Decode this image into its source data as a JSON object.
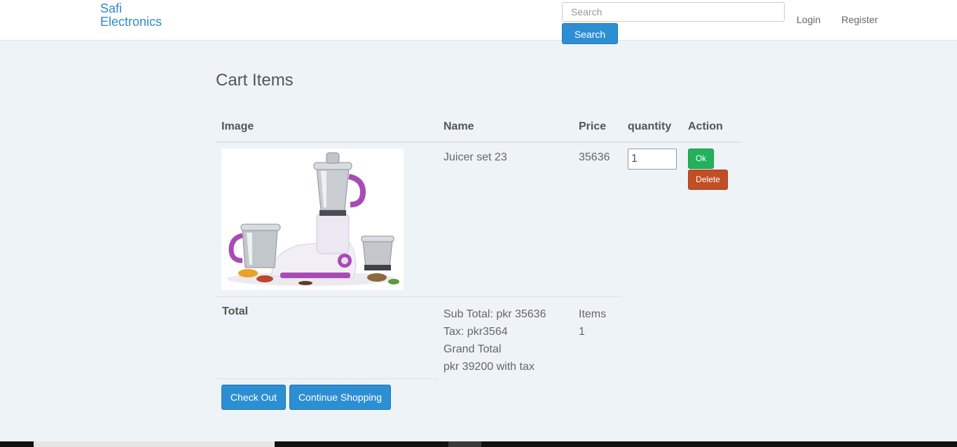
{
  "header": {
    "brand": "Safi Electronics",
    "search_placeholder": "Search",
    "search_button": "Search",
    "login": "Login",
    "register": "Register"
  },
  "page": {
    "title": "Cart Items"
  },
  "table": {
    "columns": [
      "Image",
      "Name",
      "Price",
      "quantity",
      "Action"
    ],
    "rows": [
      {
        "name": "Juicer set 23",
        "price": "35636",
        "quantity": "1",
        "ok_label": "Ok",
        "delete_label": "Delete"
      }
    ]
  },
  "totals": {
    "label": "Total",
    "sub_total": "Sub Total: pkr 35636",
    "tax": "Tax: pkr3564",
    "grand_total_label": "Grand Total",
    "grand_total_value": "pkr 39200 with tax",
    "items_label": "Items",
    "items_count": "1"
  },
  "actions": {
    "checkout": "Check Out",
    "continue": "Continue Shopping"
  },
  "colors": {
    "brand": "#2e8bc9",
    "primary": "#2d8fd3",
    "success": "#23b15c",
    "danger": "#c24e26",
    "background": "#eef3f7",
    "appliance_accent": "#a94bb7"
  }
}
